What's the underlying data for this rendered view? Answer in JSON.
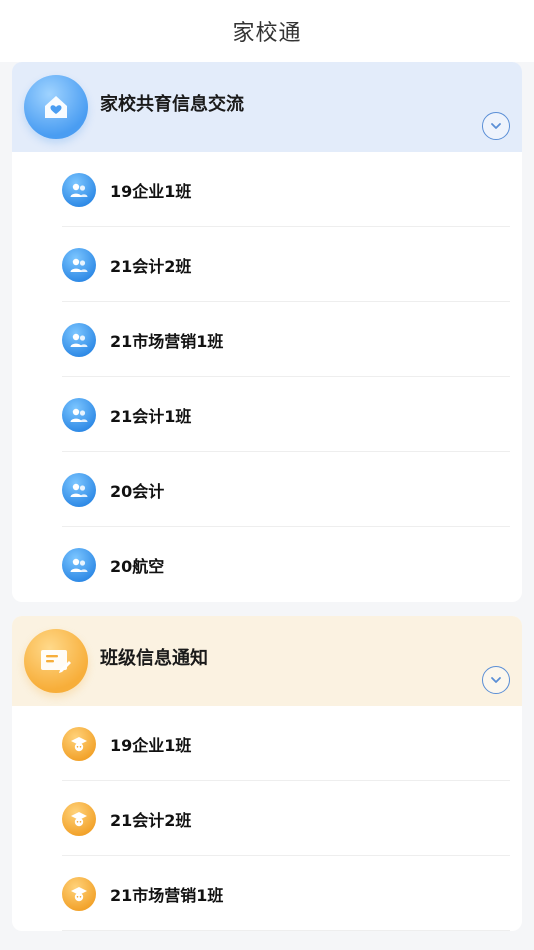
{
  "nav": {
    "title": "家校通"
  },
  "sections": [
    {
      "title": "家校共育信息交流",
      "icon": "home-heart-icon",
      "items": [
        "19企业1班",
        "21会计2班",
        "21市场营销1班",
        "21会计1班",
        "20会计",
        "20航空"
      ]
    },
    {
      "title": "班级信息通知",
      "icon": "notice-board-icon",
      "items": [
        "19企业1班",
        "21会计2班",
        "21市场营销1班"
      ]
    }
  ],
  "colors": {
    "accent_blue": "#4a9df2",
    "accent_yellow": "#f7ae3a",
    "header_blue_bg": "#e3ecfa",
    "header_yellow_bg": "#fbf2e1"
  }
}
